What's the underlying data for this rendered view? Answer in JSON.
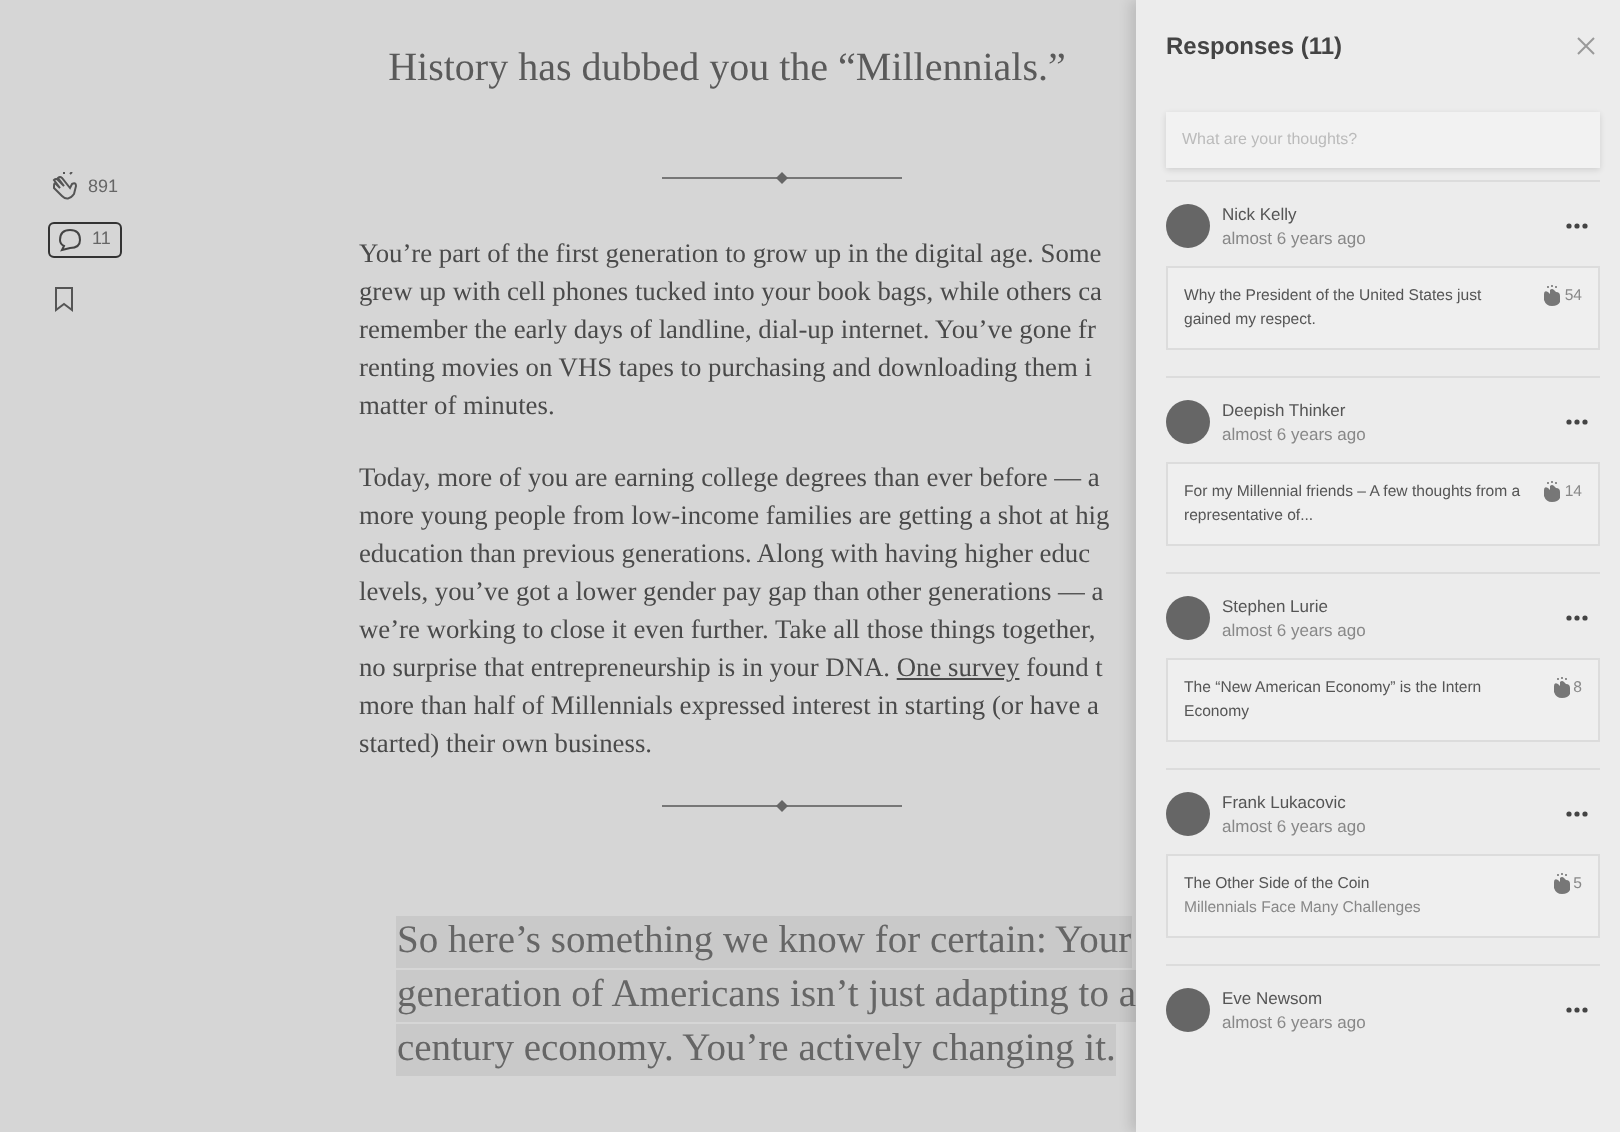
{
  "actions": {
    "claps": "891",
    "responses": "11"
  },
  "article": {
    "title": "History has dubbed you the “Millennials.”",
    "blocks": [
      {
        "kind": "divider"
      },
      {
        "kind": "paragraph",
        "lines": [
          [
            {
              "kind": "text",
              "text": "You’re part of the first generation to grow up in the digital age. Some"
            }
          ],
          [
            {
              "kind": "text",
              "text": "grew up with cell phones tucked into your book bags, while others ca"
            }
          ],
          [
            {
              "kind": "text",
              "text": "remember the early days of landline, dial-up internet. You’ve gone fr"
            }
          ],
          [
            {
              "kind": "text",
              "text": "renting movies on VHS tapes to purchasing and downloading them i"
            }
          ],
          [
            {
              "kind": "text",
              "text": "matter of minutes."
            }
          ]
        ]
      },
      {
        "kind": "paragraph",
        "lines": [
          [
            {
              "kind": "text",
              "text": "Today, more of you are earning college degrees than ever before — a"
            }
          ],
          [
            {
              "kind": "text",
              "text": "more young people from low-income families are getting a shot at hig"
            }
          ],
          [
            {
              "kind": "text",
              "text": "education than previous generations. Along with having higher educ"
            }
          ],
          [
            {
              "kind": "text",
              "text": "levels, you’ve got a lower gender pay gap than other generations — a"
            }
          ],
          [
            {
              "kind": "text",
              "text": "we’re working to close it even further. Take all those things together,"
            }
          ],
          [
            {
              "kind": "text",
              "text": "no surprise that entrepreneurship is in your DNA. "
            },
            {
              "kind": "link",
              "text": "One survey"
            },
            {
              "kind": "text",
              "text": " found t"
            }
          ],
          [
            {
              "kind": "text",
              "text": "more than half of Millennials expressed interest in starting (or have a"
            }
          ],
          [
            {
              "kind": "text",
              "text": "started) their own business."
            }
          ]
        ]
      },
      {
        "kind": "divider"
      },
      {
        "kind": "quote",
        "lines": [
          [
            {
              "kind": "text",
              "text": "So here’s something we know for certain: Your"
            }
          ],
          [
            {
              "kind": "text",
              "text": "generation of Americans isn’t just adapting to a"
            }
          ],
          [
            {
              "kind": "text",
              "text": "century economy. You’re actively changing it."
            }
          ]
        ]
      }
    ]
  },
  "responses_panel": {
    "title": "Responses (11)",
    "placeholder": "What are your thoughts?",
    "responses": [
      {
        "name": "Nick Kelly",
        "time": "almost 6 years ago",
        "card": {
          "title": "Why the President of the United States just gained my respect.",
          "claps": "54"
        }
      },
      {
        "name": "Deepish Thinker",
        "time": "almost 6 years ago",
        "card": {
          "title": "For my Millennial friends – A few thoughts from a representative of...",
          "claps": "14"
        }
      },
      {
        "name": "Stephen Lurie",
        "time": "almost 6 years ago",
        "card": {
          "title": "The “New American Economy” is the Intern Economy",
          "claps": "8"
        }
      },
      {
        "name": "Frank Lukacovic",
        "time": "almost 6 years ago",
        "card": {
          "title": "The Other Side of the Coin",
          "subtitle": "Millennials Face Many Challenges",
          "claps": "5"
        }
      },
      {
        "name": "Eve Newsom",
        "time": "almost 6 years ago"
      }
    ]
  }
}
